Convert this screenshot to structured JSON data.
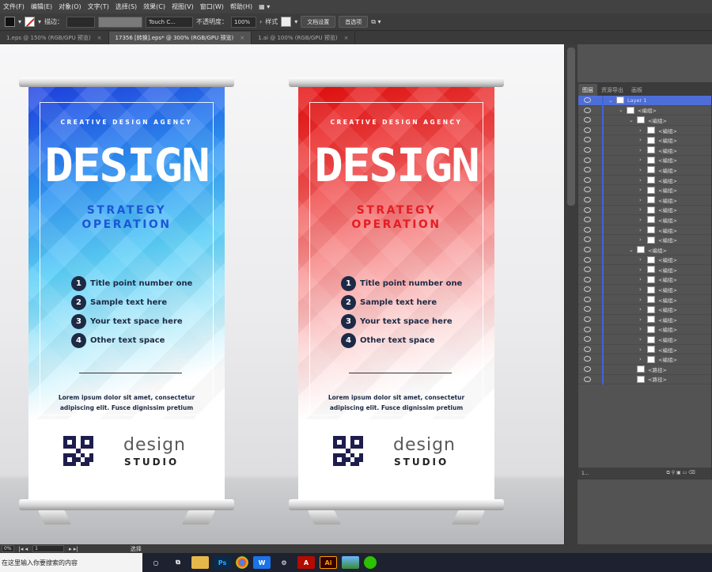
{
  "menu": [
    "文件(F)",
    "编辑(E)",
    "对象(O)",
    "文字(T)",
    "选择(S)",
    "效果(C)",
    "视图(V)",
    "窗口(W)",
    "帮助(H)"
  ],
  "control_bar": {
    "stroke_label": "描边：",
    "brush": "Touch C...",
    "opacity_label": "不透明度：",
    "opacity_value": "100%",
    "style_label": "样式",
    "doc_setup": "文档设置",
    "preferences": "首选项"
  },
  "tabs": [
    {
      "label": "1.eps @ 150% (RGB/GPU 预览)",
      "close": "×"
    },
    {
      "label": "17356 [转换].eps* @ 300% (RGB/GPU 预览)",
      "close": "×"
    },
    {
      "label": "1.ai @ 100% (RGB/GPU 预览)",
      "close": "×"
    }
  ],
  "banners": [
    {
      "agency": "CREATIVE DESIGN AGENCY",
      "headline": "DESIGN",
      "sub1": "STRATEGY",
      "sub2": "OPERATION",
      "points": [
        {
          "num": "1",
          "text": "Title point number one"
        },
        {
          "num": "2",
          "text": "Sample text here"
        },
        {
          "num": "3",
          "text": "Your text space here"
        },
        {
          "num": "4",
          "text": "Other text space"
        }
      ],
      "lorem1": "Lorem ipsum dolor sit amet, consectetur",
      "lorem2": "adipiscing elit. Fusce dignissim pretium",
      "studio_line1": "design",
      "studio_line2": "STUDIO"
    },
    {
      "agency": "CREATIVE DESIGN AGENCY",
      "headline": "DESIGN",
      "sub1": "STRATEGY",
      "sub2": "OPERATION",
      "points": [
        {
          "num": "1",
          "text": "Title point number one"
        },
        {
          "num": "2",
          "text": "Sample text here"
        },
        {
          "num": "3",
          "text": "Your text space here"
        },
        {
          "num": "4",
          "text": "Other text space"
        }
      ],
      "lorem1": "Lorem ipsum dolor sit amet, consectetur",
      "lorem2": "adipiscing elit. Fusce dignissim pretium",
      "studio_line1": "design",
      "studio_line2": "STUDIO"
    }
  ],
  "layers_panel": {
    "tabs": [
      "图层",
      "资源导出",
      "画板"
    ],
    "layer_name": "Layer 1",
    "group_label": "<编组>",
    "path_label": "<路径>",
    "footer_text": "1..."
  },
  "status": {
    "zoom": "0%",
    "page": "1",
    "tool": "选择"
  },
  "taskbar": {
    "search_placeholder": "在这里输入你要搜索的内容"
  }
}
